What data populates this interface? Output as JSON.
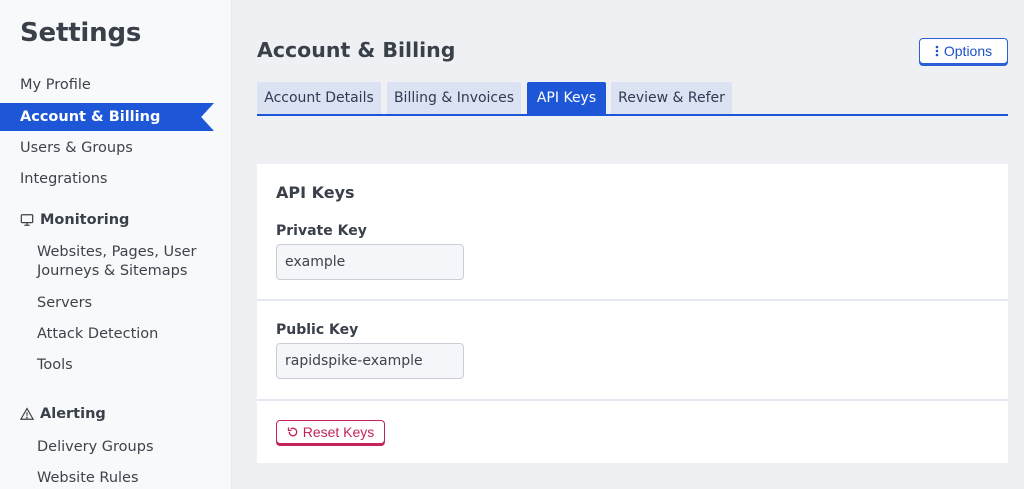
{
  "sidebar": {
    "title": "Settings",
    "items": {
      "my_profile": "My Profile",
      "account_billing": "Account & Billing",
      "users_groups": "Users & Groups",
      "integrations": "Integrations"
    },
    "monitoring": {
      "label": "Monitoring",
      "icon": "monitor-icon",
      "websites_line1": "Websites, Pages, User",
      "websites_line2": "Journeys & Sitemaps",
      "servers": "Servers",
      "attack_detection": "Attack Detection",
      "tools": "Tools"
    },
    "alerting": {
      "label": "Alerting",
      "icon": "warning-triangle-icon",
      "delivery_groups": "Delivery Groups",
      "website_rules": "Website Rules"
    }
  },
  "header": {
    "title": "Account & Billing",
    "options_label": "Options",
    "options_icon": "vertical-ellipsis-icon"
  },
  "tabs": {
    "account_details": "Account Details",
    "billing_invoices": "Billing & Invoices",
    "api_keys": "API Keys",
    "review_refer": "Review & Refer",
    "active": "API Keys"
  },
  "card": {
    "heading": "API Keys",
    "private_key_label": "Private Key",
    "private_key_value": "example",
    "public_key_label": "Public Key",
    "public_key_value": "rapidspike-example",
    "reset_label": "Reset Keys",
    "reset_icon": "rotate-ccw-icon"
  },
  "colors": {
    "accent": "#1d56d6",
    "danger": "#c4245a",
    "tab_inactive": "#dbe3f3",
    "background": "#eef0f4"
  }
}
